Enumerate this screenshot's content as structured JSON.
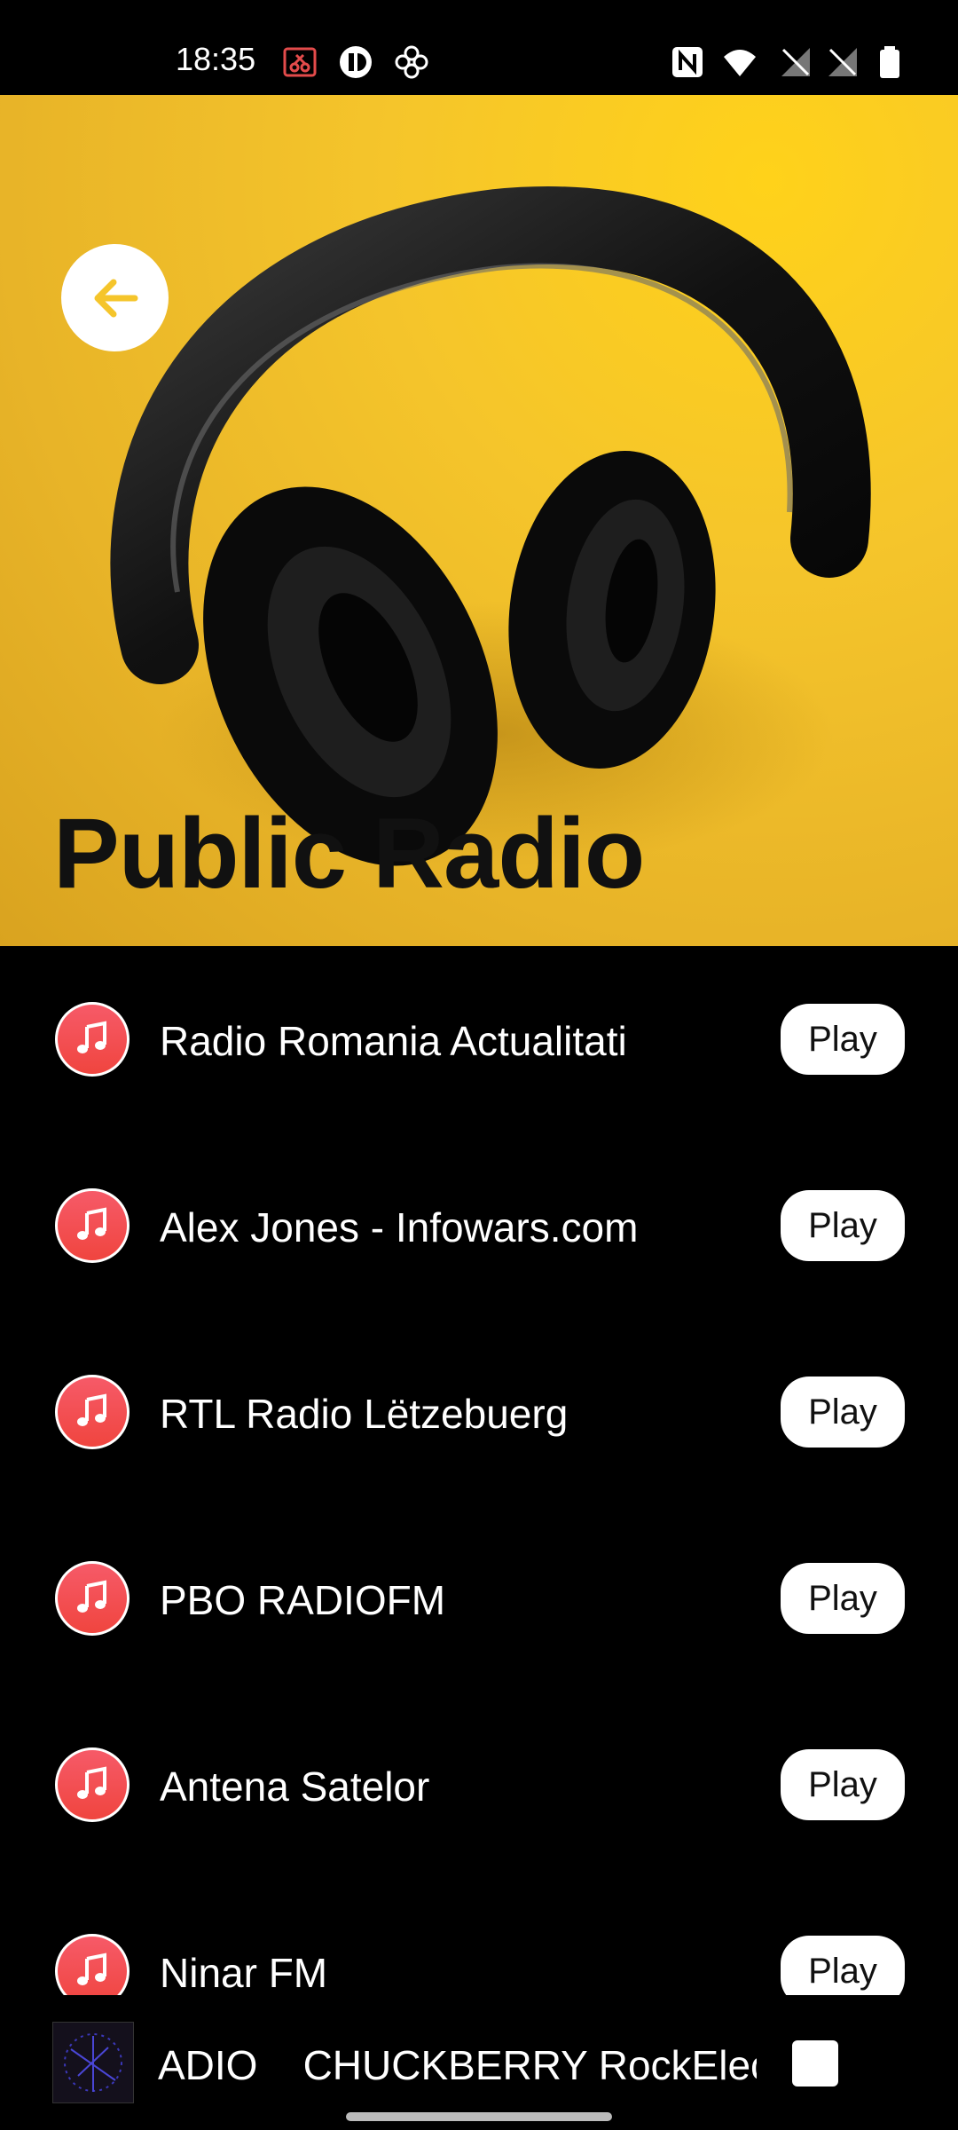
{
  "status_bar": {
    "time": "18:35",
    "icons_left": [
      "screenshot-icon",
      "info-icon",
      "pinwheel-icon"
    ],
    "icons_right": [
      "nfc-icon",
      "wifi-icon",
      "no-signal-icon",
      "no-signal-icon",
      "battery-icon"
    ]
  },
  "header": {
    "title": "Public Radio",
    "background_color": "#f5c52b",
    "back_icon": "arrow-left-icon",
    "back_icon_color": "#f5c52b"
  },
  "stations": [
    {
      "name": "Radio Romania Actualitati",
      "action": "Play"
    },
    {
      "name": "Alex Jones - Infowars.com",
      "action": "Play"
    },
    {
      "name": "RTL Radio Lëtzebuerg",
      "action": "Play"
    },
    {
      "name": "PBO RADIOFM",
      "action": "Play"
    },
    {
      "name": "Antena Satelor",
      "action": "Play"
    },
    {
      "name": "Ninar FM",
      "action": "Play"
    }
  ],
  "station_icon": "music-note-icon",
  "station_icon_color": "#f24b4f",
  "player": {
    "now_playing": "ADIO    CHUCKBERRY RockElect",
    "stop_icon": "stop-icon"
  }
}
